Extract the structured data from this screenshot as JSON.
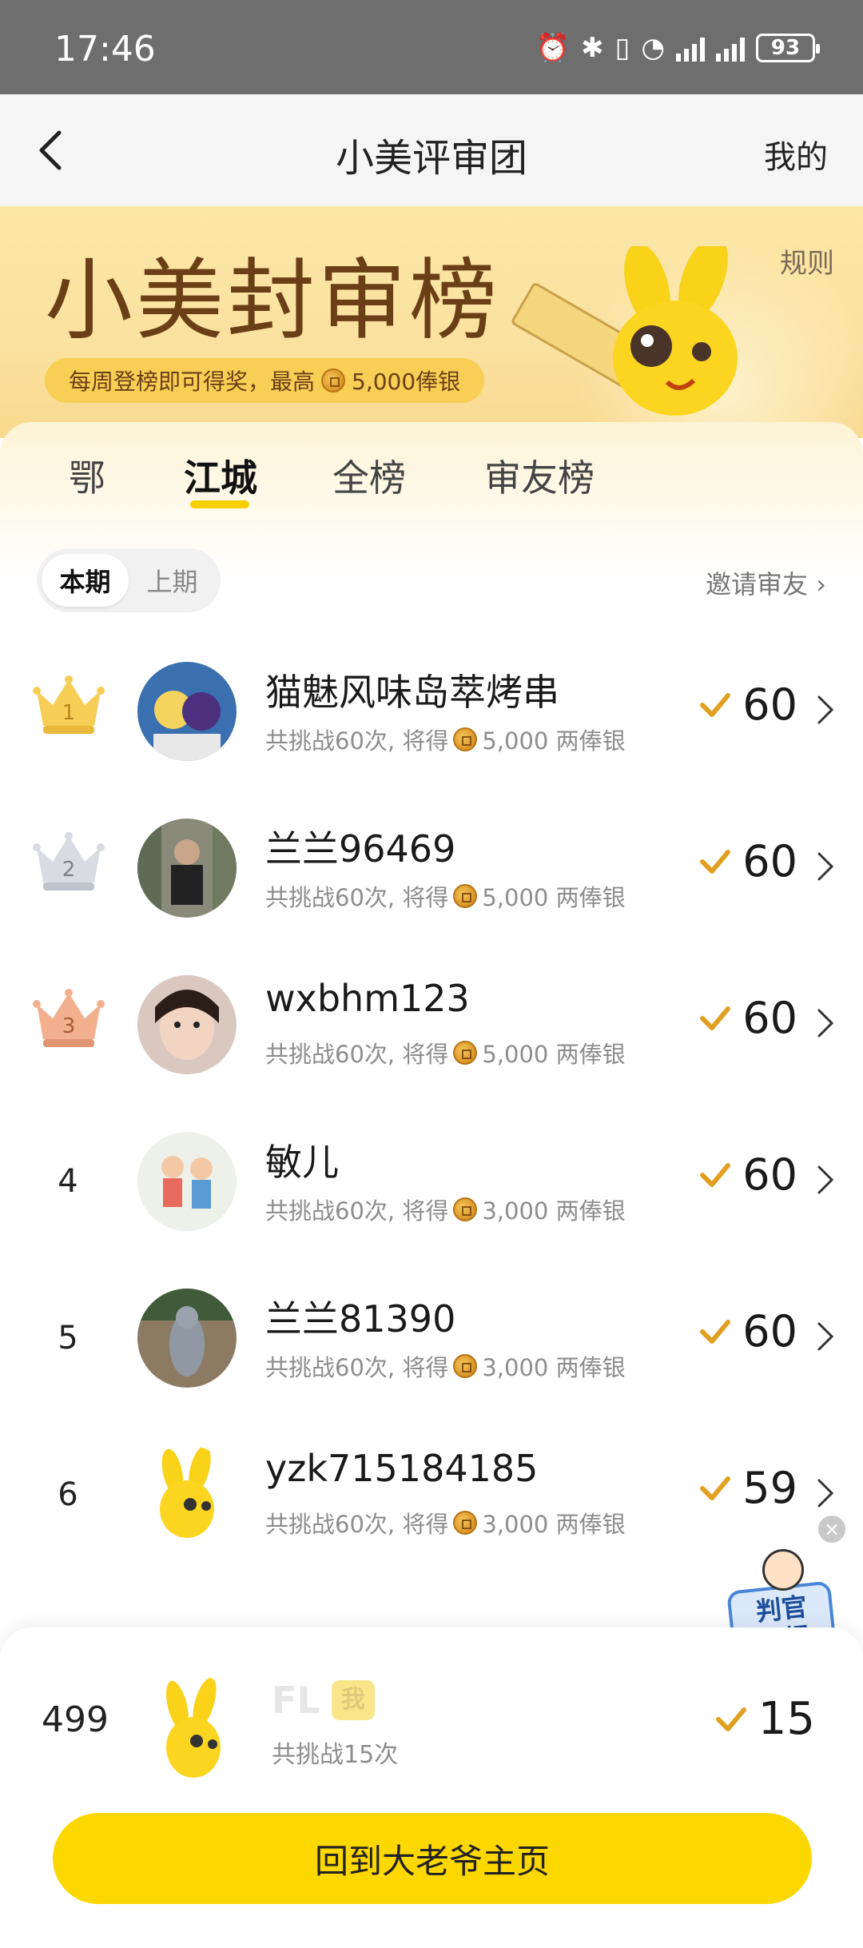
{
  "status_bar": {
    "time": "17:46",
    "battery": "93"
  },
  "nav": {
    "title": "小美评审团",
    "right_label": "我的"
  },
  "banner": {
    "title": "小美封审榜",
    "reward_text_1": "每周登榜即可得奖，最高",
    "reward_amount": "5,000俸银",
    "rules_label": "规则"
  },
  "tabs": [
    {
      "label": "鄂"
    },
    {
      "label": "江城"
    },
    {
      "label": "全榜"
    },
    {
      "label": "审友榜"
    }
  ],
  "period": {
    "current": "本期",
    "previous": "上期"
  },
  "invite_label": "邀请审友",
  "leaderboard": [
    {
      "rank": "1",
      "name": "猫魅风味岛萃烤串",
      "sub_prefix": "共挑战60次, 将得",
      "sub_reward": "5,000 两俸银",
      "score": "60"
    },
    {
      "rank": "2",
      "name": "兰兰96469",
      "sub_prefix": "共挑战60次, 将得",
      "sub_reward": "5,000 两俸银",
      "score": "60"
    },
    {
      "rank": "3",
      "name": "wxbhm123",
      "sub_prefix": "共挑战60次, 将得",
      "sub_reward": "5,000 两俸银",
      "score": "60"
    },
    {
      "rank": "4",
      "name": "敏儿",
      "sub_prefix": "共挑战60次, 将得",
      "sub_reward": "3,000 两俸银",
      "score": "60"
    },
    {
      "rank": "5",
      "name": "兰兰81390",
      "sub_prefix": "共挑战60次, 将得",
      "sub_reward": "3,000 两俸银",
      "score": "60"
    },
    {
      "rank": "6",
      "name": "yzk715184185",
      "sub_prefix": "共挑战60次, 将得",
      "sub_reward": "3,000 两俸银",
      "score": "59"
    }
  ],
  "float_badge": {
    "label_line1": "判官",
    "label_line2": "日报"
  },
  "me": {
    "rank": "499",
    "name": "FL",
    "tag": "我",
    "sub": "共挑战15次",
    "score": "15"
  },
  "home_button": "回到大老爷主页",
  "colors": {
    "accent": "#fcd800",
    "check": "#e0a020",
    "brown": "#6b3f16"
  }
}
